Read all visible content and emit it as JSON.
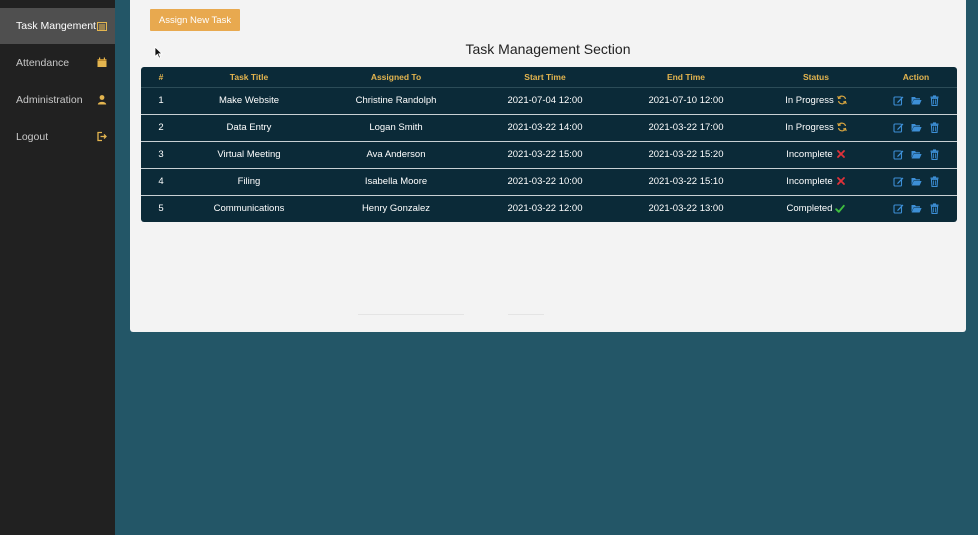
{
  "sidebar": {
    "items": [
      {
        "label": "Task Mangement",
        "icon": "tasks-icon",
        "active": true
      },
      {
        "label": "Attendance",
        "icon": "calendar-icon",
        "active": false
      },
      {
        "label": "Administration",
        "icon": "user-icon",
        "active": false
      },
      {
        "label": "Logout",
        "icon": "logout-icon",
        "active": false
      }
    ]
  },
  "main": {
    "assign_button": "Assign New Task",
    "title": "Task Management Section",
    "table": {
      "headers": [
        "#",
        "Task Title",
        "Assigned To",
        "Start Time",
        "End Time",
        "Status",
        "Action"
      ],
      "rows": [
        {
          "num": "1",
          "title": "Make Website",
          "assigned": "Christine Randolph",
          "start": "2021-07-04 12:00",
          "end": "2021-07-10 12:00",
          "status": "In Progress",
          "status_icon": "refresh-icon"
        },
        {
          "num": "2",
          "title": "Data Entry",
          "assigned": "Logan Smith",
          "start": "2021-03-22 14:00",
          "end": "2021-03-22 17:00",
          "status": "In Progress",
          "status_icon": "refresh-icon"
        },
        {
          "num": "3",
          "title": "Virtual Meeting",
          "assigned": "Ava Anderson",
          "start": "2021-03-22 15:00",
          "end": "2021-03-22 15:20",
          "status": "Incomplete",
          "status_icon": "cross-icon"
        },
        {
          "num": "4",
          "title": "Filing",
          "assigned": "Isabella Moore",
          "start": "2021-03-22 10:00",
          "end": "2021-03-22 15:10",
          "status": "Incomplete",
          "status_icon": "cross-icon"
        },
        {
          "num": "5",
          "title": "Communications",
          "assigned": "Henry Gonzalez",
          "start": "2021-03-22 12:00",
          "end": "2021-03-22 13:00",
          "status": "Completed",
          "status_icon": "check-icon"
        }
      ]
    }
  },
  "colors": {
    "page_background": "#235667",
    "sidebar": "#212121",
    "sidebar_active": "#4f4f4f",
    "panel": "#f3f3f3",
    "accent_button": "#e8a94f",
    "table_background": "#0b2a38",
    "header_text": "#e4b54f",
    "in_progress": "#d9a640",
    "incomplete": "#e0323a",
    "completed": "#3fbf3f",
    "action_icon": "#3d8fd6"
  }
}
